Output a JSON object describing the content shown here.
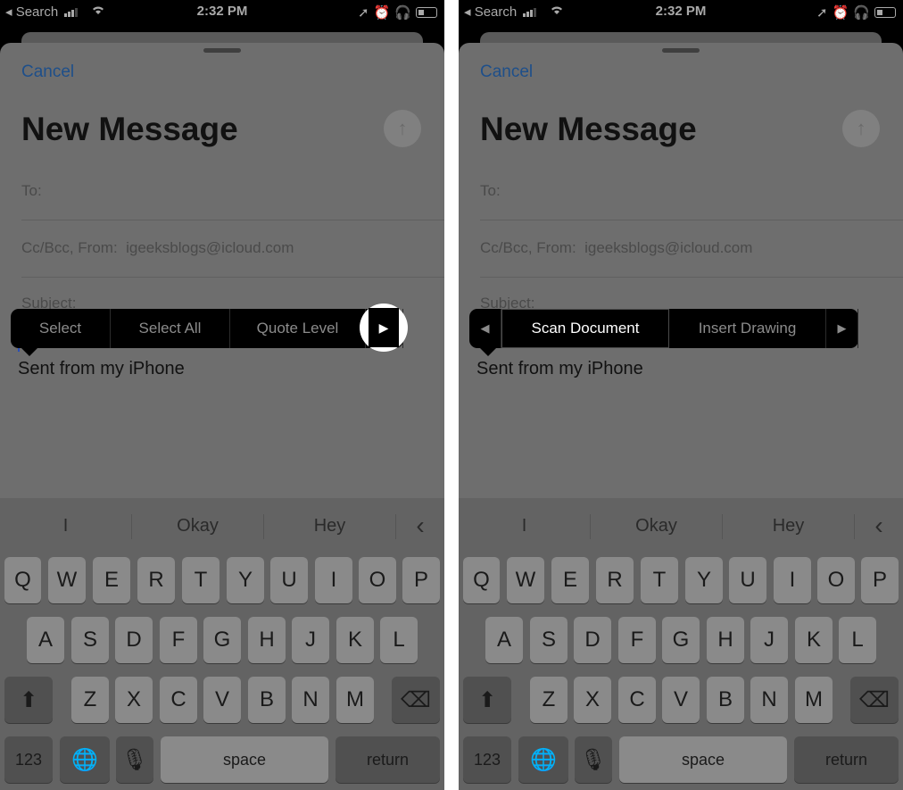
{
  "status_bar": {
    "carrier": "Search",
    "time": "2:32 PM"
  },
  "compose": {
    "cancel_label": "Cancel",
    "title": "New Message",
    "to_label": "To:",
    "cc_label": "Cc/Bcc, From:",
    "from_email": "igeeksblogs@icloud.com",
    "subject_label": "Subject:",
    "signature": "Sent from my iPhone"
  },
  "edit_menu_left": {
    "items": [
      "Select",
      "Select All",
      "Quote Level"
    ]
  },
  "edit_menu_right": {
    "items": [
      "Scan Document",
      "Insert Drawing"
    ]
  },
  "keyboard": {
    "suggestions": [
      "I",
      "Okay",
      "Hey"
    ],
    "row1": [
      "Q",
      "W",
      "E",
      "R",
      "T",
      "Y",
      "U",
      "I",
      "O",
      "P"
    ],
    "row2": [
      "A",
      "S",
      "D",
      "F",
      "G",
      "H",
      "J",
      "K",
      "L"
    ],
    "row3": [
      "Z",
      "X",
      "C",
      "V",
      "B",
      "N",
      "M"
    ],
    "numbers_label": "123",
    "space_label": "space",
    "return_label": "return"
  },
  "icons": [
    "signal-icon",
    "wifi-icon",
    "location-icon",
    "alarm-icon",
    "headphones-icon",
    "battery-icon",
    "send-icon",
    "arrow-left-icon",
    "arrow-right-icon",
    "chevron-left-icon",
    "shift-icon",
    "delete-icon",
    "globe-icon",
    "microphone-icon"
  ]
}
